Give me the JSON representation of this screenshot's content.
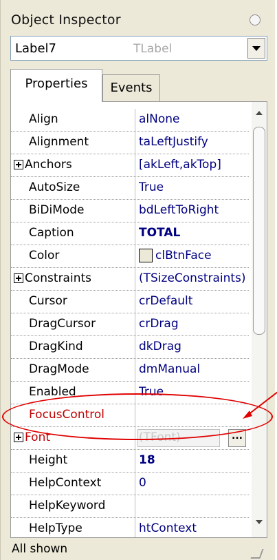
{
  "window": {
    "title": "Object Inspector"
  },
  "component_selector": {
    "name": "Label7",
    "type": "TLabel"
  },
  "tabs": [
    {
      "label": "Properties",
      "active": true
    },
    {
      "label": "Events",
      "active": false
    }
  ],
  "properties": [
    {
      "name": "Align",
      "value": "alNone"
    },
    {
      "name": "Alignment",
      "value": "taLeftJustify"
    },
    {
      "name": "Anchors",
      "value": "[akLeft,akTop]",
      "expandable": true
    },
    {
      "name": "AutoSize",
      "value": "True"
    },
    {
      "name": "BiDiMode",
      "value": "bdLeftToRight"
    },
    {
      "name": "Caption",
      "value": "TOTAL",
      "bold_value": true
    },
    {
      "name": "Color",
      "value": "clBtnFace",
      "swatch_color": "#ece9d8"
    },
    {
      "name": "Constraints",
      "value": "(TSizeConstraints)",
      "expandable": true
    },
    {
      "name": "Cursor",
      "value": "crDefault"
    },
    {
      "name": "DragCursor",
      "value": "crDrag"
    },
    {
      "name": "DragKind",
      "value": "dkDrag"
    },
    {
      "name": "DragMode",
      "value": "dmManual"
    },
    {
      "name": "Enabled",
      "value": "True"
    },
    {
      "name": "FocusControl",
      "value": "",
      "name_color": "#c00000"
    },
    {
      "name": "Font",
      "value": "(TFont)",
      "expandable": true,
      "selected": true,
      "name_color": "#c00000",
      "button_label": "..."
    },
    {
      "name": "Height",
      "value": "18",
      "bold_value": true
    },
    {
      "name": "HelpContext",
      "value": "0"
    },
    {
      "name": "HelpKeyword",
      "value": ""
    },
    {
      "name": "HelpType",
      "value": "htContext"
    }
  ],
  "status_bar": {
    "text": "All shown"
  },
  "colors": {
    "highlight": "#e00000",
    "value_text": "#000080",
    "window_bg": "#ece9d8"
  }
}
